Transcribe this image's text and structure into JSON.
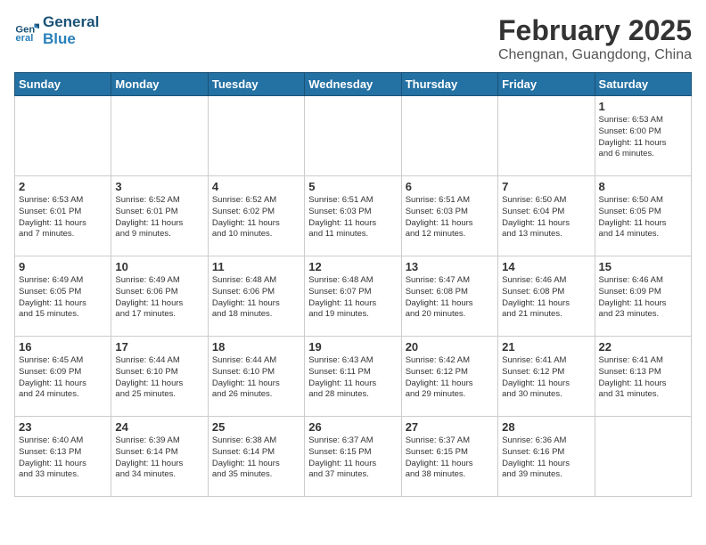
{
  "logo": {
    "line1": "General",
    "line2": "Blue"
  },
  "title": "February 2025",
  "subtitle": "Chengnan, Guangdong, China",
  "headers": [
    "Sunday",
    "Monday",
    "Tuesday",
    "Wednesday",
    "Thursday",
    "Friday",
    "Saturday"
  ],
  "weeks": [
    [
      {
        "day": "",
        "info": ""
      },
      {
        "day": "",
        "info": ""
      },
      {
        "day": "",
        "info": ""
      },
      {
        "day": "",
        "info": ""
      },
      {
        "day": "",
        "info": ""
      },
      {
        "day": "",
        "info": ""
      },
      {
        "day": "1",
        "info": "Sunrise: 6:53 AM\nSunset: 6:00 PM\nDaylight: 11 hours\nand 6 minutes."
      }
    ],
    [
      {
        "day": "2",
        "info": "Sunrise: 6:53 AM\nSunset: 6:01 PM\nDaylight: 11 hours\nand 7 minutes."
      },
      {
        "day": "3",
        "info": "Sunrise: 6:52 AM\nSunset: 6:01 PM\nDaylight: 11 hours\nand 9 minutes."
      },
      {
        "day": "4",
        "info": "Sunrise: 6:52 AM\nSunset: 6:02 PM\nDaylight: 11 hours\nand 10 minutes."
      },
      {
        "day": "5",
        "info": "Sunrise: 6:51 AM\nSunset: 6:03 PM\nDaylight: 11 hours\nand 11 minutes."
      },
      {
        "day": "6",
        "info": "Sunrise: 6:51 AM\nSunset: 6:03 PM\nDaylight: 11 hours\nand 12 minutes."
      },
      {
        "day": "7",
        "info": "Sunrise: 6:50 AM\nSunset: 6:04 PM\nDaylight: 11 hours\nand 13 minutes."
      },
      {
        "day": "8",
        "info": "Sunrise: 6:50 AM\nSunset: 6:05 PM\nDaylight: 11 hours\nand 14 minutes."
      }
    ],
    [
      {
        "day": "9",
        "info": "Sunrise: 6:49 AM\nSunset: 6:05 PM\nDaylight: 11 hours\nand 15 minutes."
      },
      {
        "day": "10",
        "info": "Sunrise: 6:49 AM\nSunset: 6:06 PM\nDaylight: 11 hours\nand 17 minutes."
      },
      {
        "day": "11",
        "info": "Sunrise: 6:48 AM\nSunset: 6:06 PM\nDaylight: 11 hours\nand 18 minutes."
      },
      {
        "day": "12",
        "info": "Sunrise: 6:48 AM\nSunset: 6:07 PM\nDaylight: 11 hours\nand 19 minutes."
      },
      {
        "day": "13",
        "info": "Sunrise: 6:47 AM\nSunset: 6:08 PM\nDaylight: 11 hours\nand 20 minutes."
      },
      {
        "day": "14",
        "info": "Sunrise: 6:46 AM\nSunset: 6:08 PM\nDaylight: 11 hours\nand 21 minutes."
      },
      {
        "day": "15",
        "info": "Sunrise: 6:46 AM\nSunset: 6:09 PM\nDaylight: 11 hours\nand 23 minutes."
      }
    ],
    [
      {
        "day": "16",
        "info": "Sunrise: 6:45 AM\nSunset: 6:09 PM\nDaylight: 11 hours\nand 24 minutes."
      },
      {
        "day": "17",
        "info": "Sunrise: 6:44 AM\nSunset: 6:10 PM\nDaylight: 11 hours\nand 25 minutes."
      },
      {
        "day": "18",
        "info": "Sunrise: 6:44 AM\nSunset: 6:10 PM\nDaylight: 11 hours\nand 26 minutes."
      },
      {
        "day": "19",
        "info": "Sunrise: 6:43 AM\nSunset: 6:11 PM\nDaylight: 11 hours\nand 28 minutes."
      },
      {
        "day": "20",
        "info": "Sunrise: 6:42 AM\nSunset: 6:12 PM\nDaylight: 11 hours\nand 29 minutes."
      },
      {
        "day": "21",
        "info": "Sunrise: 6:41 AM\nSunset: 6:12 PM\nDaylight: 11 hours\nand 30 minutes."
      },
      {
        "day": "22",
        "info": "Sunrise: 6:41 AM\nSunset: 6:13 PM\nDaylight: 11 hours\nand 31 minutes."
      }
    ],
    [
      {
        "day": "23",
        "info": "Sunrise: 6:40 AM\nSunset: 6:13 PM\nDaylight: 11 hours\nand 33 minutes."
      },
      {
        "day": "24",
        "info": "Sunrise: 6:39 AM\nSunset: 6:14 PM\nDaylight: 11 hours\nand 34 minutes."
      },
      {
        "day": "25",
        "info": "Sunrise: 6:38 AM\nSunset: 6:14 PM\nDaylight: 11 hours\nand 35 minutes."
      },
      {
        "day": "26",
        "info": "Sunrise: 6:37 AM\nSunset: 6:15 PM\nDaylight: 11 hours\nand 37 minutes."
      },
      {
        "day": "27",
        "info": "Sunrise: 6:37 AM\nSunset: 6:15 PM\nDaylight: 11 hours\nand 38 minutes."
      },
      {
        "day": "28",
        "info": "Sunrise: 6:36 AM\nSunset: 6:16 PM\nDaylight: 11 hours\nand 39 minutes."
      },
      {
        "day": "",
        "info": ""
      }
    ]
  ]
}
